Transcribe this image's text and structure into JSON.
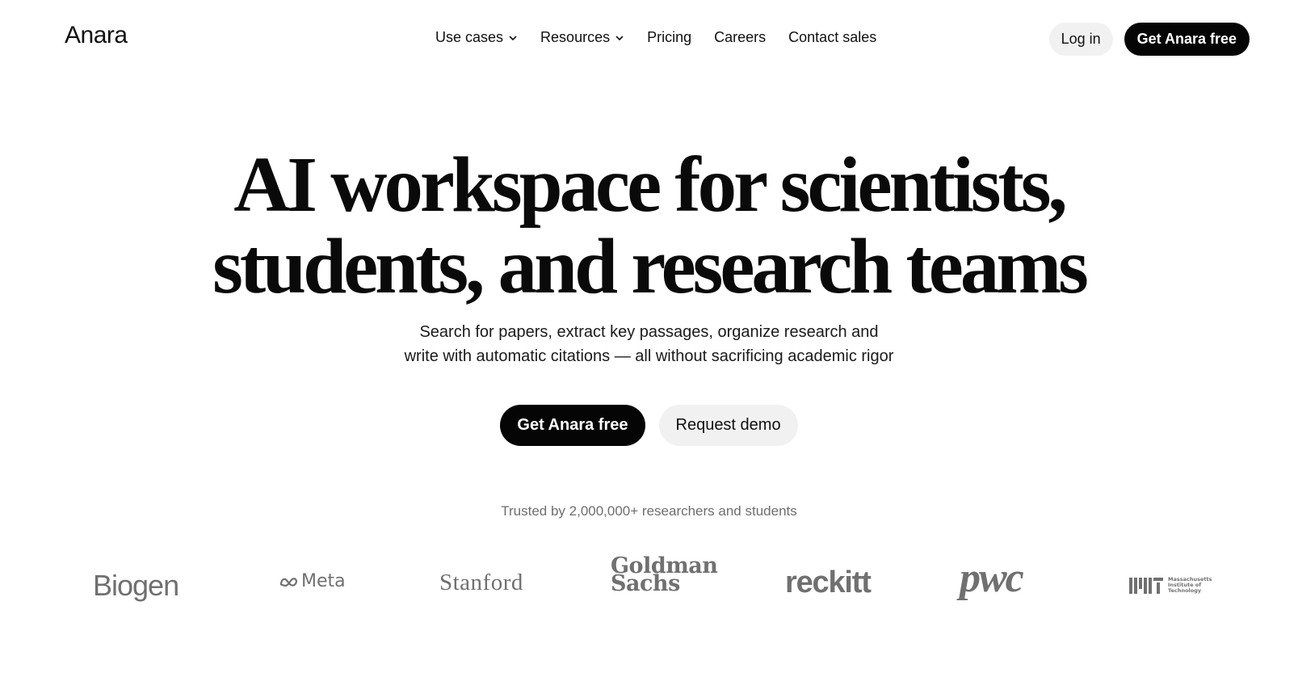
{
  "header": {
    "brand": "Anara",
    "nav": [
      {
        "label": "Use cases",
        "has_dropdown": true
      },
      {
        "label": "Resources",
        "has_dropdown": true
      },
      {
        "label": "Pricing",
        "has_dropdown": false
      },
      {
        "label": "Careers",
        "has_dropdown": false
      },
      {
        "label": "Contact sales",
        "has_dropdown": false
      }
    ],
    "login_label": "Log in",
    "cta_label": "Get Anara free"
  },
  "hero": {
    "title_line1": "AI workspace for scientists,",
    "title_line2": "students, and research teams",
    "subtitle_line1": "Search for papers, extract key passages, organize research and",
    "subtitle_line2": "write with automatic citations — all without sacrificing academic rigor",
    "primary_cta": "Get Anara free",
    "secondary_cta": "Request demo"
  },
  "trusted": {
    "text": "Trusted by 2,000,000+ researchers and students",
    "logos": {
      "biogen": "Biogen",
      "meta": "Meta",
      "stanford": "Stanford",
      "goldman_line1": "Goldman",
      "goldman_line2": "Sachs",
      "reckitt": "reckitt",
      "pwc": "pwc",
      "mit_line1": "Massachusetts",
      "mit_line2": "Institute of",
      "mit_line3": "Technology"
    }
  },
  "colors": {
    "primary_button": "#050505",
    "secondary_button": "#f1f1f1",
    "logo_gray": "#707070",
    "muted_text": "#6e6e6e"
  }
}
